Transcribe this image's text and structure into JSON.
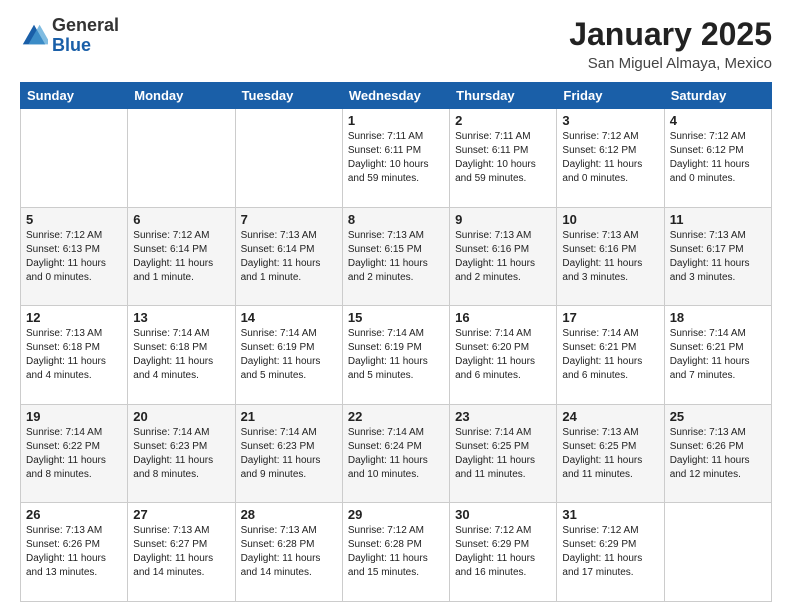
{
  "header": {
    "logo_general": "General",
    "logo_blue": "Blue",
    "month_title": "January 2025",
    "location": "San Miguel Almaya, Mexico"
  },
  "weekdays": [
    "Sunday",
    "Monday",
    "Tuesday",
    "Wednesday",
    "Thursday",
    "Friday",
    "Saturday"
  ],
  "weeks": [
    [
      {
        "day": "",
        "info": ""
      },
      {
        "day": "",
        "info": ""
      },
      {
        "day": "",
        "info": ""
      },
      {
        "day": "1",
        "info": "Sunrise: 7:11 AM\nSunset: 6:11 PM\nDaylight: 10 hours\nand 59 minutes."
      },
      {
        "day": "2",
        "info": "Sunrise: 7:11 AM\nSunset: 6:11 PM\nDaylight: 10 hours\nand 59 minutes."
      },
      {
        "day": "3",
        "info": "Sunrise: 7:12 AM\nSunset: 6:12 PM\nDaylight: 11 hours\nand 0 minutes."
      },
      {
        "day": "4",
        "info": "Sunrise: 7:12 AM\nSunset: 6:12 PM\nDaylight: 11 hours\nand 0 minutes."
      }
    ],
    [
      {
        "day": "5",
        "info": "Sunrise: 7:12 AM\nSunset: 6:13 PM\nDaylight: 11 hours\nand 0 minutes."
      },
      {
        "day": "6",
        "info": "Sunrise: 7:12 AM\nSunset: 6:14 PM\nDaylight: 11 hours\nand 1 minute."
      },
      {
        "day": "7",
        "info": "Sunrise: 7:13 AM\nSunset: 6:14 PM\nDaylight: 11 hours\nand 1 minute."
      },
      {
        "day": "8",
        "info": "Sunrise: 7:13 AM\nSunset: 6:15 PM\nDaylight: 11 hours\nand 2 minutes."
      },
      {
        "day": "9",
        "info": "Sunrise: 7:13 AM\nSunset: 6:16 PM\nDaylight: 11 hours\nand 2 minutes."
      },
      {
        "day": "10",
        "info": "Sunrise: 7:13 AM\nSunset: 6:16 PM\nDaylight: 11 hours\nand 3 minutes."
      },
      {
        "day": "11",
        "info": "Sunrise: 7:13 AM\nSunset: 6:17 PM\nDaylight: 11 hours\nand 3 minutes."
      }
    ],
    [
      {
        "day": "12",
        "info": "Sunrise: 7:13 AM\nSunset: 6:18 PM\nDaylight: 11 hours\nand 4 minutes."
      },
      {
        "day": "13",
        "info": "Sunrise: 7:14 AM\nSunset: 6:18 PM\nDaylight: 11 hours\nand 4 minutes."
      },
      {
        "day": "14",
        "info": "Sunrise: 7:14 AM\nSunset: 6:19 PM\nDaylight: 11 hours\nand 5 minutes."
      },
      {
        "day": "15",
        "info": "Sunrise: 7:14 AM\nSunset: 6:19 PM\nDaylight: 11 hours\nand 5 minutes."
      },
      {
        "day": "16",
        "info": "Sunrise: 7:14 AM\nSunset: 6:20 PM\nDaylight: 11 hours\nand 6 minutes."
      },
      {
        "day": "17",
        "info": "Sunrise: 7:14 AM\nSunset: 6:21 PM\nDaylight: 11 hours\nand 6 minutes."
      },
      {
        "day": "18",
        "info": "Sunrise: 7:14 AM\nSunset: 6:21 PM\nDaylight: 11 hours\nand 7 minutes."
      }
    ],
    [
      {
        "day": "19",
        "info": "Sunrise: 7:14 AM\nSunset: 6:22 PM\nDaylight: 11 hours\nand 8 minutes."
      },
      {
        "day": "20",
        "info": "Sunrise: 7:14 AM\nSunset: 6:23 PM\nDaylight: 11 hours\nand 8 minutes."
      },
      {
        "day": "21",
        "info": "Sunrise: 7:14 AM\nSunset: 6:23 PM\nDaylight: 11 hours\nand 9 minutes."
      },
      {
        "day": "22",
        "info": "Sunrise: 7:14 AM\nSunset: 6:24 PM\nDaylight: 11 hours\nand 10 minutes."
      },
      {
        "day": "23",
        "info": "Sunrise: 7:14 AM\nSunset: 6:25 PM\nDaylight: 11 hours\nand 11 minutes."
      },
      {
        "day": "24",
        "info": "Sunrise: 7:13 AM\nSunset: 6:25 PM\nDaylight: 11 hours\nand 11 minutes."
      },
      {
        "day": "25",
        "info": "Sunrise: 7:13 AM\nSunset: 6:26 PM\nDaylight: 11 hours\nand 12 minutes."
      }
    ],
    [
      {
        "day": "26",
        "info": "Sunrise: 7:13 AM\nSunset: 6:26 PM\nDaylight: 11 hours\nand 13 minutes."
      },
      {
        "day": "27",
        "info": "Sunrise: 7:13 AM\nSunset: 6:27 PM\nDaylight: 11 hours\nand 14 minutes."
      },
      {
        "day": "28",
        "info": "Sunrise: 7:13 AM\nSunset: 6:28 PM\nDaylight: 11 hours\nand 14 minutes."
      },
      {
        "day": "29",
        "info": "Sunrise: 7:12 AM\nSunset: 6:28 PM\nDaylight: 11 hours\nand 15 minutes."
      },
      {
        "day": "30",
        "info": "Sunrise: 7:12 AM\nSunset: 6:29 PM\nDaylight: 11 hours\nand 16 minutes."
      },
      {
        "day": "31",
        "info": "Sunrise: 7:12 AM\nSunset: 6:29 PM\nDaylight: 11 hours\nand 17 minutes."
      },
      {
        "day": "",
        "info": ""
      }
    ]
  ]
}
